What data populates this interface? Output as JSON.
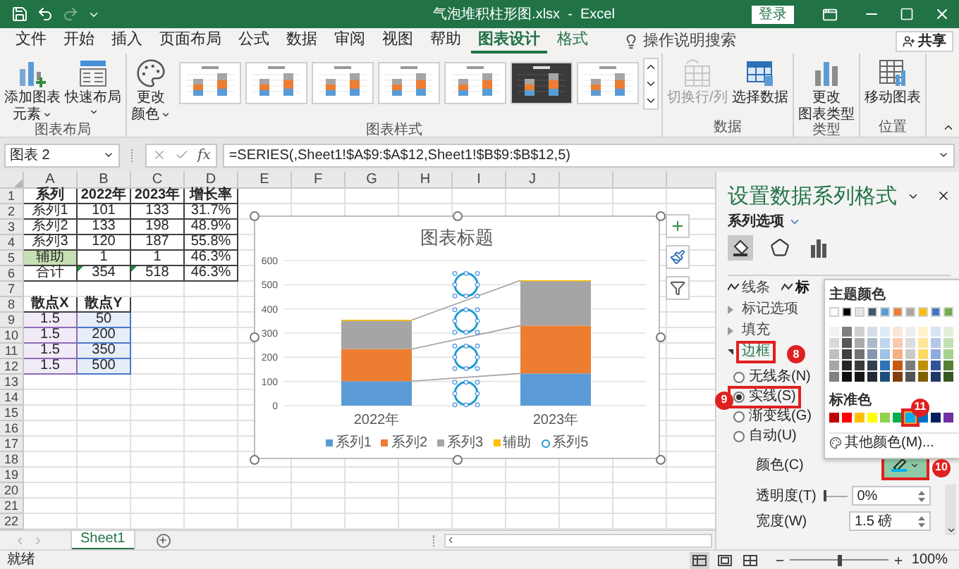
{
  "title_bar": {
    "quick_access": [
      {
        "kind": "save",
        "disabled": false
      },
      {
        "kind": "undo",
        "disabled": false
      },
      {
        "kind": "redo",
        "disabled": true
      },
      {
        "kind": "customize",
        "disabled": false
      }
    ],
    "title": "气泡堆积柱形图.xlsx  -  Excel",
    "login": "登录"
  },
  "menu_tabs": [
    {
      "label": "文件",
      "selected": false,
      "contextual": false
    },
    {
      "label": "开始",
      "selected": false,
      "contextual": false
    },
    {
      "label": "插入",
      "selected": false,
      "contextual": false
    },
    {
      "label": "页面布局",
      "selected": false,
      "contextual": false
    },
    {
      "label": "公式",
      "selected": false,
      "contextual": false
    },
    {
      "label": "数据",
      "selected": false,
      "contextual": false
    },
    {
      "label": "审阅",
      "selected": false,
      "contextual": false
    },
    {
      "label": "视图",
      "selected": false,
      "contextual": false
    },
    {
      "label": "帮助",
      "selected": false,
      "contextual": false
    },
    {
      "label": "图表设计",
      "selected": true,
      "contextual": true
    },
    {
      "label": "格式",
      "selected": false,
      "contextual": true
    }
  ],
  "tell_me": "操作说明搜索",
  "share": "共享",
  "ribbon": {
    "groups": [
      {
        "label": "图表布局",
        "buttons": [
          {
            "kind": "add_element",
            "lines": [
              "添加图表",
              "元素"
            ],
            "dropdown": true,
            "disabled": false
          },
          {
            "kind": "quick_layout",
            "lines": [
              "快速布局"
            ],
            "dropdown": true,
            "disabled": false
          }
        ]
      },
      {
        "label": "图表样式",
        "buttons": [
          {
            "kind": "change_colors",
            "lines": [
              "更改",
              "颜色"
            ],
            "dropdown": true,
            "disabled": false
          }
        ],
        "gallery": [
          {
            "kind": "light"
          },
          {
            "kind": "light"
          },
          {
            "kind": "light"
          },
          {
            "kind": "light"
          },
          {
            "kind": "light"
          },
          {
            "kind": "dark"
          },
          {
            "kind": "light"
          }
        ]
      },
      {
        "label": "数据",
        "buttons": [
          {
            "kind": "switch_row_col",
            "lines": [
              "切换行/列"
            ],
            "dropdown": false,
            "disabled": true
          },
          {
            "kind": "select_data",
            "lines": [
              "选择数据"
            ],
            "dropdown": false,
            "disabled": false
          }
        ]
      },
      {
        "label": "类型",
        "buttons": [
          {
            "kind": "change_type",
            "lines": [
              "更改",
              "图表类型"
            ],
            "dropdown": false,
            "disabled": false
          }
        ]
      },
      {
        "label": "位置",
        "buttons": [
          {
            "kind": "move_chart",
            "lines": [
              "移动图表"
            ],
            "dropdown": false,
            "disabled": false
          }
        ]
      }
    ]
  },
  "formula_bar": {
    "name_box": "图表 2",
    "function_label": "fx",
    "formula": "=SERIES(,Sheet1!$A$9:$A$12,Sheet1!$B$9:$B$12,5)"
  },
  "sheet": {
    "column_headers": [
      "A",
      "B",
      "C",
      "D",
      "E",
      "F",
      "G",
      "H",
      "I",
      "J"
    ],
    "row_numbers": [
      "1",
      "2",
      "3",
      "4",
      "5",
      "6",
      "7",
      "8",
      "9",
      "10",
      "11",
      "12",
      "13",
      "14",
      "15",
      "16",
      "17",
      "18",
      "19",
      "20",
      "21",
      "22"
    ],
    "table_1": {
      "header": [
        "系列",
        "2022年",
        "2023年",
        "增长率"
      ],
      "rows": [
        {
          "cells": [
            "系列1",
            "101",
            "133",
            "31.7%"
          ],
          "label_highlighted": false,
          "error_flags": false
        },
        {
          "cells": [
            "系列2",
            "133",
            "198",
            "48.9%"
          ],
          "label_highlighted": false,
          "error_flags": false
        },
        {
          "cells": [
            "系列3",
            "120",
            "187",
            "55.8%"
          ],
          "label_highlighted": false,
          "error_flags": false
        },
        {
          "cells": [
            "辅助",
            "1",
            "1",
            "46.3%"
          ],
          "label_highlighted": true,
          "error_flags": false
        },
        {
          "cells": [
            "合计",
            "354",
            "518",
            "46.3%"
          ],
          "label_highlighted": false,
          "error_flags": true
        }
      ]
    },
    "table_2": {
      "header": [
        "散点X",
        "散点Y"
      ],
      "range_highlight": true,
      "rows": [
        {
          "cells": [
            "1.5",
            "50"
          ]
        },
        {
          "cells": [
            "1.5",
            "200"
          ]
        },
        {
          "cells": [
            "1.5",
            "350"
          ]
        },
        {
          "cells": [
            "1.5",
            "500"
          ]
        }
      ]
    }
  },
  "chart": {
    "selected": true,
    "side_buttons": [
      {
        "kind": "elements"
      },
      {
        "kind": "styles"
      },
      {
        "kind": "filter"
      }
    ],
    "chart_data": {
      "type": "bar",
      "title": "图表标题",
      "grid": true,
      "legend": "bottom",
      "categories": [
        "2022年",
        "2023年"
      ],
      "stacked": true,
      "ylim": [
        0,
        600
      ],
      "yticks": [
        {
          "value": 0,
          "label": "0"
        },
        {
          "value": 100,
          "label": "100"
        },
        {
          "value": 200,
          "label": "200"
        },
        {
          "value": 300,
          "label": "300"
        },
        {
          "value": 400,
          "label": "400"
        },
        {
          "value": 500,
          "label": "500"
        },
        {
          "value": 600,
          "label": "600"
        }
      ],
      "series": [
        {
          "name": "系列1",
          "color": "#5b9bd5",
          "values": [
            101,
            133
          ]
        },
        {
          "name": "系列2",
          "color": "#ed7d31",
          "values": [
            133,
            198
          ]
        },
        {
          "name": "系列3",
          "color": "#a5a5a5",
          "values": [
            120,
            187
          ]
        },
        {
          "name": "辅助",
          "color": "#ffc000",
          "values": [
            1,
            1
          ]
        }
      ]
    },
    "marker_series": {
      "name": "系列5",
      "color": "#1f9bcf",
      "selected": true
    }
  },
  "format_pane": {
    "title": "设置数据系列格式",
    "options_label": "系列选项",
    "icon_tabs": [
      {
        "kind": "fill_line",
        "selected": true
      },
      {
        "kind": "effects",
        "selected": false
      },
      {
        "kind": "series_options",
        "selected": false
      }
    ],
    "sub_tabs": [
      {
        "label": "线条",
        "selected": false
      },
      {
        "label": "标",
        "selected": true
      }
    ],
    "sections": [
      {
        "label": "标记选项",
        "expanded": false
      },
      {
        "label": "填充",
        "expanded": false
      },
      {
        "label": "边框",
        "expanded": true,
        "annotation": "8"
      }
    ],
    "line_options": [
      {
        "label": "无线条(N)",
        "selected": false
      },
      {
        "label": "实线(S)",
        "selected": true,
        "annotation": "9"
      },
      {
        "label": "渐变线(G)",
        "selected": false
      },
      {
        "label": "自动(U)",
        "selected": false
      }
    ],
    "color": {
      "label": "颜色(C)",
      "color": "#00b0f0",
      "open": true,
      "annotation": "10"
    },
    "transparency": {
      "label": "透明度(T)",
      "value": "0%",
      "level": 0
    },
    "width": {
      "label": "宽度(W)",
      "value": "1.5 磅"
    }
  },
  "color_popup": {
    "theme_label": "主题颜色",
    "theme_colors": [
      {
        "color": "#ffffff",
        "selected": false,
        "shades": [
          {
            "color": "#f2f2f2",
            "selected": false
          },
          {
            "color": "#d9d9d9",
            "selected": false
          },
          {
            "color": "#bfbfbf",
            "selected": false
          },
          {
            "color": "#a6a6a6",
            "selected": false
          },
          {
            "color": "#808080",
            "selected": false
          }
        ]
      },
      {
        "color": "#000000",
        "selected": false,
        "shades": [
          {
            "color": "#808080",
            "selected": false
          },
          {
            "color": "#595959",
            "selected": false
          },
          {
            "color": "#404040",
            "selected": false
          },
          {
            "color": "#262626",
            "selected": false
          },
          {
            "color": "#0d0d0d",
            "selected": false
          }
        ]
      },
      {
        "color": "#e7e6e6",
        "selected": false,
        "shades": [
          {
            "color": "#d0cece",
            "selected": false
          },
          {
            "color": "#aeaaaa",
            "selected": false
          },
          {
            "color": "#757171",
            "selected": false
          },
          {
            "color": "#3a3838",
            "selected": false
          },
          {
            "color": "#171616",
            "selected": false
          }
        ]
      },
      {
        "color": "#44546a",
        "selected": false,
        "shades": [
          {
            "color": "#d6dce5",
            "selected": false
          },
          {
            "color": "#adb9ca",
            "selected": false
          },
          {
            "color": "#8497b0",
            "selected": false
          },
          {
            "color": "#333f50",
            "selected": false
          },
          {
            "color": "#222a35",
            "selected": false
          }
        ]
      },
      {
        "color": "#5b9bd5",
        "selected": false,
        "shades": [
          {
            "color": "#deebf7",
            "selected": false
          },
          {
            "color": "#bdd7ee",
            "selected": false
          },
          {
            "color": "#9dc3e6",
            "selected": false
          },
          {
            "color": "#2e75b6",
            "selected": false
          },
          {
            "color": "#1f4e79",
            "selected": false
          }
        ]
      },
      {
        "color": "#ed7d31",
        "selected": false,
        "shades": [
          {
            "color": "#fbe5d6",
            "selected": false
          },
          {
            "color": "#f8cbad",
            "selected": false
          },
          {
            "color": "#f4b183",
            "selected": false
          },
          {
            "color": "#c55a11",
            "selected": false
          },
          {
            "color": "#843c0c",
            "selected": false
          }
        ]
      },
      {
        "color": "#a5a5a5",
        "selected": false,
        "shades": [
          {
            "color": "#ededed",
            "selected": false
          },
          {
            "color": "#dbdbdb",
            "selected": false
          },
          {
            "color": "#c9c9c9",
            "selected": false
          },
          {
            "color": "#7b7b7b",
            "selected": false
          },
          {
            "color": "#525252",
            "selected": false
          }
        ]
      },
      {
        "color": "#ffc000",
        "selected": false,
        "shades": [
          {
            "color": "#fff2cc",
            "selected": false
          },
          {
            "color": "#ffe699",
            "selected": false
          },
          {
            "color": "#ffd966",
            "selected": false
          },
          {
            "color": "#bf9000",
            "selected": false
          },
          {
            "color": "#7f6000",
            "selected": false
          }
        ]
      },
      {
        "color": "#4472c4",
        "selected": false,
        "shades": [
          {
            "color": "#dae3f3",
            "selected": false
          },
          {
            "color": "#b4c7e7",
            "selected": false
          },
          {
            "color": "#8faadc",
            "selected": false
          },
          {
            "color": "#2f5597",
            "selected": false
          },
          {
            "color": "#203864",
            "selected": false
          }
        ]
      },
      {
        "color": "#70ad47",
        "selected": false,
        "shades": [
          {
            "color": "#e2f0d9",
            "selected": false
          },
          {
            "color": "#c5e0b4",
            "selected": false
          },
          {
            "color": "#a9d18e",
            "selected": false
          },
          {
            "color": "#548235",
            "selected": false
          },
          {
            "color": "#385723",
            "selected": false
          }
        ]
      }
    ],
    "standard_label": "标准色",
    "standard_colors": [
      {
        "color": "#c00000",
        "selected": false
      },
      {
        "color": "#ff0000",
        "selected": false
      },
      {
        "color": "#ffc000",
        "selected": false
      },
      {
        "color": "#ffff00",
        "selected": false
      },
      {
        "color": "#92d050",
        "selected": false
      },
      {
        "color": "#00b050",
        "selected": false
      },
      {
        "color": "#00b0f0",
        "selected": true,
        "annotation": "11"
      },
      {
        "color": "#0070c0",
        "selected": false
      },
      {
        "color": "#002060",
        "selected": false
      },
      {
        "color": "#7030a0",
        "selected": false
      }
    ],
    "more_label": "其他颜色(M)..."
  },
  "sheet_tabs": [
    {
      "label": "Sheet1",
      "selected": true
    }
  ],
  "status_bar": {
    "status": "就绪",
    "view_modes": [
      {
        "kind": "normal",
        "selected": true
      },
      {
        "kind": "page_layout",
        "selected": false
      },
      {
        "kind": "page_break",
        "selected": false
      }
    ],
    "zoom_slider": {
      "level": 0.5
    },
    "zoom": "100%"
  }
}
